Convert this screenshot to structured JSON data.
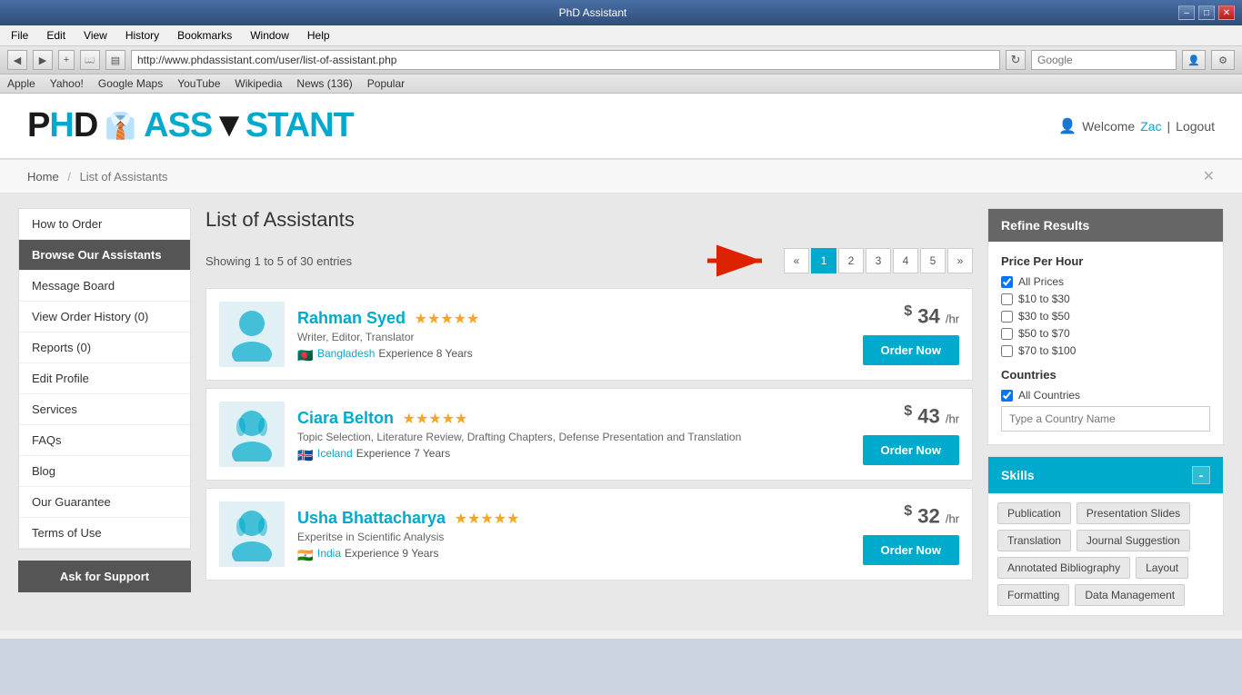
{
  "browser": {
    "titlebar": "PhD Assistant",
    "url": "http://www.phdassistant.com/user/list-of-assistant.php",
    "search_placeholder": "Google",
    "menu_items": [
      "File",
      "Edit",
      "View",
      "History",
      "Bookmarks",
      "Window",
      "Help"
    ],
    "bookmarks": [
      "Apple",
      "Yahoo!",
      "Google Maps",
      "YouTube",
      "Wikipedia",
      "News (136)",
      "Popular"
    ]
  },
  "site": {
    "logo_phd": "PHD",
    "logo_asst": "ASS▼sTANT",
    "welcome_text": "Welcome",
    "user_name": "Zac",
    "logout_text": "Logout"
  },
  "breadcrumb": {
    "home": "Home",
    "current": "List of Assistants"
  },
  "sidebar": {
    "items": [
      {
        "label": "How to Order",
        "active": false
      },
      {
        "label": "Browse Our Assistants",
        "active": true
      },
      {
        "label": "Message Board",
        "active": false
      },
      {
        "label": "View Order History (0)",
        "active": false
      },
      {
        "label": "Reports (0)",
        "active": false
      },
      {
        "label": "Edit Profile",
        "active": false
      },
      {
        "label": "Services",
        "active": false
      },
      {
        "label": "FAQs",
        "active": false
      },
      {
        "label": "Blog",
        "active": false
      },
      {
        "label": "Our Guarantee",
        "active": false
      },
      {
        "label": "Terms of Use",
        "active": false
      }
    ],
    "support_btn": "Ask for Support"
  },
  "main": {
    "page_title": "List of Assistants",
    "results_info": "Showing 1 to 5 of 30 entries",
    "pagination": {
      "prev": "«",
      "next": "»",
      "pages": [
        "1",
        "2",
        "3",
        "4",
        "5"
      ],
      "active_page": "1"
    },
    "assistants": [
      {
        "name": "Rahman Syed",
        "stars": 5,
        "specialty": "Writer, Editor, Translator",
        "country": "Bangladesh",
        "flag": "🇧🇩",
        "experience": "Experience 8 Years",
        "price": "34",
        "per_hr": "/hr",
        "avatar_gender": "male"
      },
      {
        "name": "Ciara Belton",
        "stars": 5,
        "specialty": "Topic Selection, Literature Review, Drafting Chapters, Defense Presentation and Translation",
        "country": "Iceland",
        "flag": "🇮🇸",
        "experience": "Experience 7 Years",
        "price": "43",
        "per_hr": "/hr",
        "avatar_gender": "female"
      },
      {
        "name": "Usha Bhattacharya",
        "stars": 5,
        "specialty": "Experitse in Scientific Analysis",
        "country": "India",
        "flag": "🇮🇳",
        "experience": "Experience 9 Years",
        "price": "32",
        "per_hr": "/hr",
        "avatar_gender": "female"
      }
    ],
    "order_btn": "Order Now"
  },
  "refine": {
    "title": "Refine Results",
    "price_section_title": "Price Per Hour",
    "price_options": [
      {
        "label": "All Prices",
        "checked": true
      },
      {
        "label": "$10 to $30",
        "checked": false
      },
      {
        "label": "$30 to $50",
        "checked": false
      },
      {
        "label": "$50 to $70",
        "checked": false
      },
      {
        "label": "$70 to $100",
        "checked": false
      }
    ],
    "countries_title": "Countries",
    "all_countries_label": "All Countries",
    "country_input_placeholder": "Type a Country Name"
  },
  "skills": {
    "title": "Skills",
    "collapse_btn": "-",
    "tags": [
      "Publication",
      "Presentation Slides",
      "Translation",
      "Journal Suggestion",
      "Annotated Bibliography",
      "Layout",
      "Formatting",
      "Data Management"
    ]
  }
}
